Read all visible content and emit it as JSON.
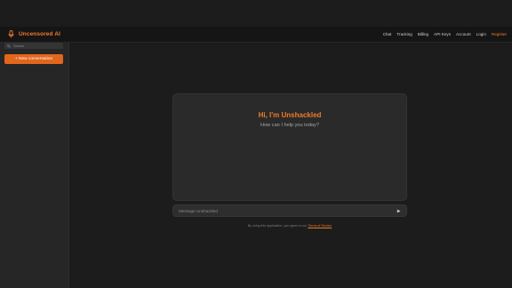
{
  "brand": {
    "name": "Uncensored AI",
    "accent_color": "#f07b2b",
    "icon": "microphone-icon"
  },
  "nav": {
    "links": [
      "Chat",
      "Tracking",
      "Billing",
      "API Keys",
      "Account",
      "Login"
    ],
    "register": "Register"
  },
  "sidebar": {
    "search_placeholder": "Search",
    "new_conversation": "+ New conversation"
  },
  "chat": {
    "greeting": "Hi, I'm Unshackled",
    "subtitle": "How can I help you today?",
    "input_placeholder": "Message Unshackled",
    "send_icon": "send-icon"
  },
  "footer": {
    "text": "By using this application, you agree to our",
    "link": "Terms of Service"
  }
}
